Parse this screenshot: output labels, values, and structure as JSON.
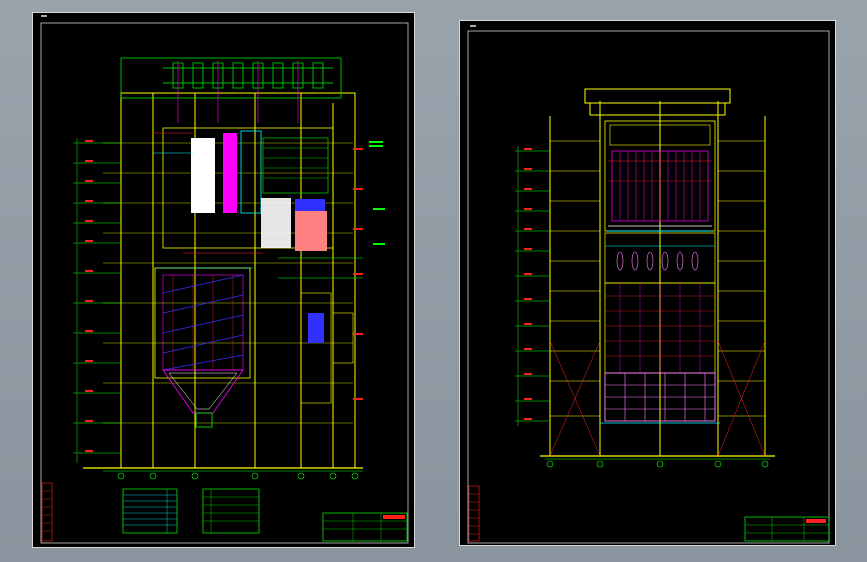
{
  "viewer": {
    "background": "#8e97a1"
  },
  "sheets": [
    {
      "id": "left",
      "label": "",
      "view": "side-elevation"
    },
    {
      "id": "right",
      "label": "",
      "view": "front-elevation"
    }
  ],
  "colors": {
    "yellow": "#ffff00",
    "green": "#00ff00",
    "red": "#ff2020",
    "magenta": "#ff00ff",
    "cyan": "#00ffff",
    "white": "#ffffff",
    "pink": "#ff80ff",
    "blue": "#3030ff",
    "orange": "#ff8040"
  }
}
